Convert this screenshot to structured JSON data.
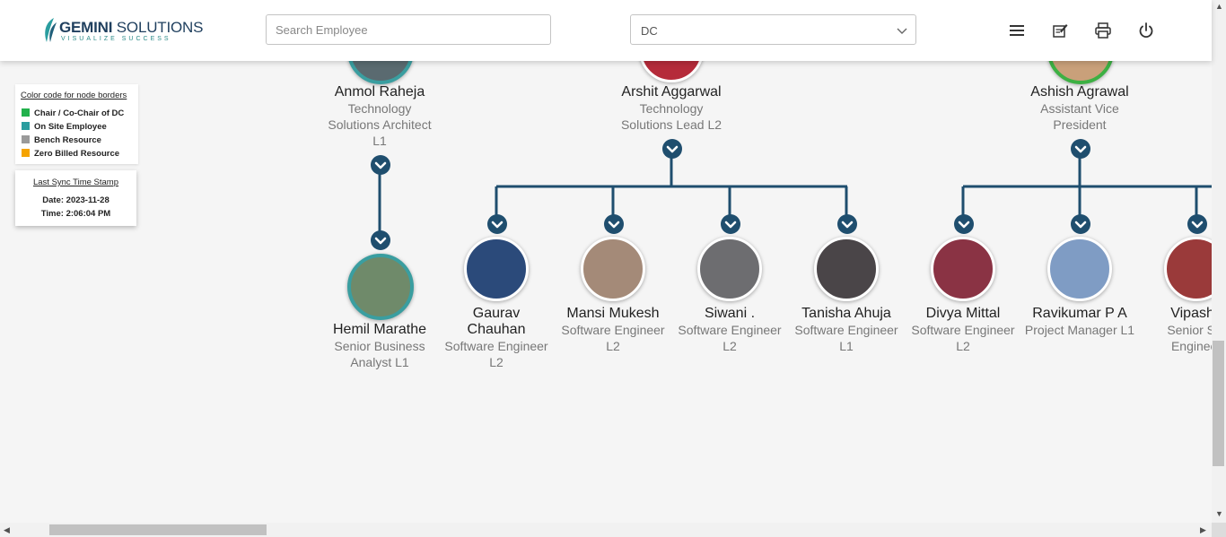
{
  "header": {
    "logo_main_bold": "GEMINI",
    "logo_main_rest": "SOLUTIONS",
    "logo_tagline": "VISUALIZE SUCCESS",
    "search_placeholder": "Search Employee",
    "selected_department": "DC",
    "icons": [
      "menu-icon",
      "note-edit-icon",
      "print-icon",
      "power-icon"
    ]
  },
  "legend": {
    "title": "Color code for node borders",
    "items": [
      {
        "label": "Chair / Co-Chair of DC",
        "color": "#22b14c"
      },
      {
        "label": "On Site Employee",
        "color": "#2a9d9f"
      },
      {
        "label": "Bench Resource",
        "color": "#9a9a9a"
      },
      {
        "label": "Zero Billed Resource",
        "color": "#f5a300"
      }
    ]
  },
  "sync": {
    "title": "Last Sync Time Stamp",
    "date": "Date: 2023-11-28",
    "time": "Time: 2:06:04 PM"
  },
  "colors": {
    "connector": "#1f4e6e",
    "onsite_border": "#3a9ea0",
    "chair_border": "#3cb043"
  },
  "tree": {
    "top_nodes": [
      {
        "name": "Anmol Raheja",
        "title": "Technology Solutions Architect L1"
      },
      {
        "name": "Arshit Aggarwal",
        "title": "Technology Solutions Lead L2"
      },
      {
        "name": "Ashish Agrawal",
        "title": "Assistant Vice President"
      }
    ],
    "child_nodes": [
      {
        "name": "Hemil Marathe",
        "title": "Senior Business Analyst L1"
      },
      {
        "name": "Gaurav Chauhan",
        "title": "Software Engineer L2"
      },
      {
        "name": "Mansi Mukesh",
        "title": "Software Engineer L2"
      },
      {
        "name": "Siwani .",
        "title": "Software Engineer L2"
      },
      {
        "name": "Tanisha Ahuja",
        "title": "Software Engineer L1"
      },
      {
        "name": "Divya Mittal",
        "title": "Software Engineer L2"
      },
      {
        "name": "Ravikumar P A",
        "title": "Project Manager L1"
      },
      {
        "name": "Vipasha",
        "title": "Senior Sof Engineer"
      }
    ]
  }
}
